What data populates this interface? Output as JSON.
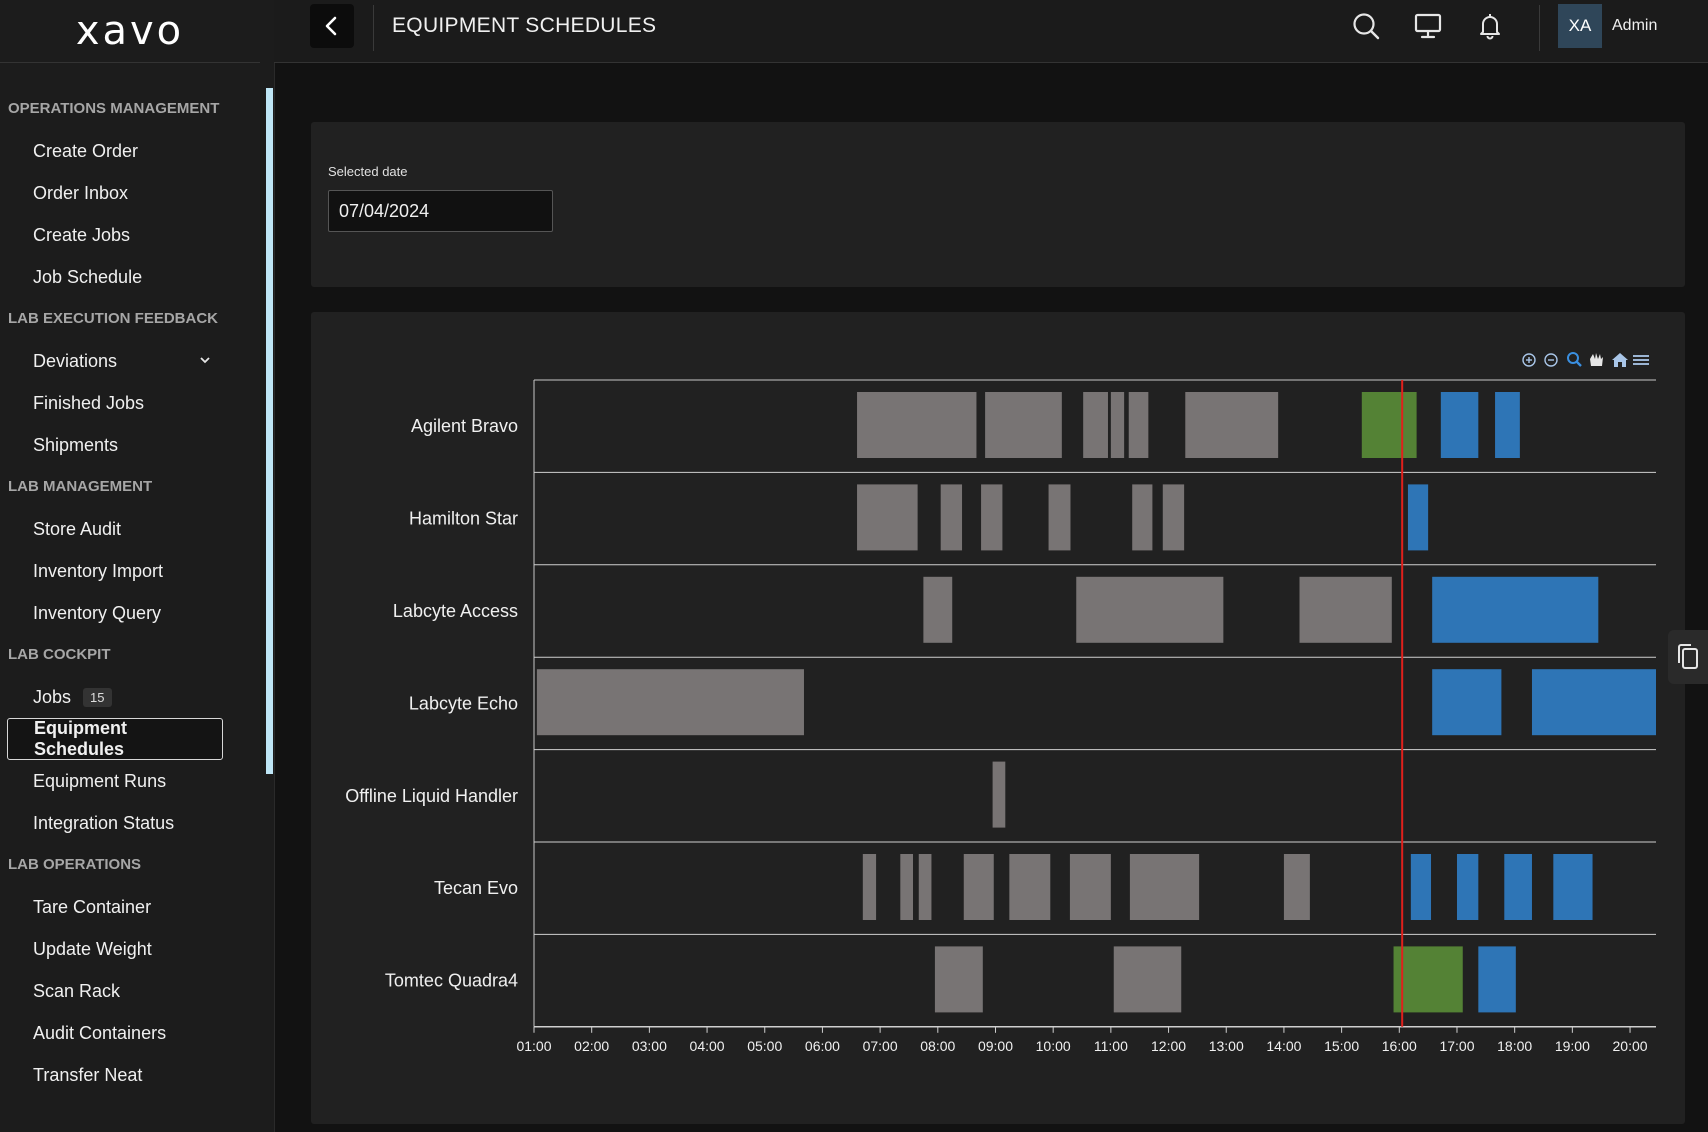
{
  "app": {
    "logo": "xavo"
  },
  "header": {
    "title": "EQUIPMENT SCHEDULES",
    "avatar_initials": "XA",
    "user_name": "Admin"
  },
  "sidebar": {
    "sections": [
      {
        "title": "OPERATIONS MANAGEMENT",
        "items": [
          {
            "label": "Create Order"
          },
          {
            "label": "Order Inbox"
          },
          {
            "label": "Create Jobs"
          },
          {
            "label": "Job Schedule"
          }
        ]
      },
      {
        "title": "LAB EXECUTION FEEDBACK",
        "items": [
          {
            "label": "Deviations",
            "expandable": true
          },
          {
            "label": "Finished Jobs"
          },
          {
            "label": "Shipments"
          }
        ]
      },
      {
        "title": "LAB MANAGEMENT",
        "items": [
          {
            "label": "Store Audit"
          },
          {
            "label": "Inventory Import"
          },
          {
            "label": "Inventory Query"
          }
        ]
      },
      {
        "title": "LAB COCKPIT",
        "items": [
          {
            "label": "Jobs",
            "badge": "15"
          },
          {
            "label": "Equipment Schedules",
            "active": true
          },
          {
            "label": "Equipment Runs"
          },
          {
            "label": "Integration Status"
          }
        ]
      },
      {
        "title": "LAB OPERATIONS",
        "items": [
          {
            "label": "Tare Container"
          },
          {
            "label": "Update Weight"
          },
          {
            "label": "Scan Rack"
          },
          {
            "label": "Audit Containers"
          },
          {
            "label": "Transfer Neat"
          }
        ]
      }
    ]
  },
  "date_filter": {
    "label": "Selected date",
    "value": "07/04/2024"
  },
  "chart_data": {
    "type": "timeline",
    "toolbar": [
      "zoom-in-icon",
      "zoom-out-icon",
      "selection-zoom-icon",
      "pan-icon",
      "reset-home-icon",
      "menu-icon"
    ],
    "x_ticks": [
      "01:00",
      "02:00",
      "03:00",
      "04:00",
      "05:00",
      "06:00",
      "07:00",
      "08:00",
      "09:00",
      "10:00",
      "11:00",
      "12:00",
      "13:00",
      "14:00",
      "15:00",
      "16:00",
      "17:00",
      "18:00",
      "19:00",
      "20:00"
    ],
    "xlim": [
      1.0,
      20.45
    ],
    "now_marker": 16.05,
    "colors": {
      "completed": "#787474",
      "running": "#548235",
      "scheduled": "#2e75b6",
      "now": "#e0201c"
    },
    "rows": [
      {
        "name": "Agilent Bravo",
        "tasks": [
          {
            "start": 6.6,
            "end": 8.67,
            "status": "completed"
          },
          {
            "start": 8.82,
            "end": 10.15,
            "status": "completed"
          },
          {
            "start": 10.52,
            "end": 10.95,
            "status": "completed"
          },
          {
            "start": 11.0,
            "end": 11.23,
            "status": "completed"
          },
          {
            "start": 11.31,
            "end": 11.65,
            "status": "completed"
          },
          {
            "start": 12.29,
            "end": 13.9,
            "status": "completed"
          },
          {
            "start": 15.35,
            "end": 16.3,
            "status": "running"
          },
          {
            "start": 16.72,
            "end": 17.37,
            "status": "scheduled"
          },
          {
            "start": 17.66,
            "end": 18.09,
            "status": "scheduled"
          }
        ]
      },
      {
        "name": "Hamilton Star",
        "tasks": [
          {
            "start": 6.6,
            "end": 7.65,
            "status": "completed"
          },
          {
            "start": 8.05,
            "end": 8.42,
            "status": "completed"
          },
          {
            "start": 8.75,
            "end": 9.12,
            "status": "completed"
          },
          {
            "start": 9.92,
            "end": 10.3,
            "status": "completed"
          },
          {
            "start": 11.37,
            "end": 11.72,
            "status": "completed"
          },
          {
            "start": 11.9,
            "end": 12.27,
            "status": "completed"
          },
          {
            "start": 16.15,
            "end": 16.5,
            "status": "scheduled"
          }
        ]
      },
      {
        "name": "Labcyte Access",
        "tasks": [
          {
            "start": 7.75,
            "end": 8.25,
            "status": "completed"
          },
          {
            "start": 10.4,
            "end": 12.95,
            "status": "completed"
          },
          {
            "start": 14.27,
            "end": 15.87,
            "status": "completed"
          },
          {
            "start": 16.57,
            "end": 19.45,
            "status": "scheduled"
          }
        ]
      },
      {
        "name": "Labcyte Echo",
        "tasks": [
          {
            "start": 1.05,
            "end": 5.68,
            "status": "completed"
          },
          {
            "start": 16.57,
            "end": 17.77,
            "status": "scheduled"
          },
          {
            "start": 18.3,
            "end": 20.45,
            "status": "scheduled"
          }
        ]
      },
      {
        "name": "Offline Liquid Handler",
        "tasks": [
          {
            "start": 8.95,
            "end": 9.17,
            "status": "completed"
          }
        ]
      },
      {
        "name": "Tecan Evo",
        "tasks": [
          {
            "start": 6.7,
            "end": 6.93,
            "status": "completed"
          },
          {
            "start": 7.35,
            "end": 7.57,
            "status": "completed"
          },
          {
            "start": 7.67,
            "end": 7.89,
            "status": "completed"
          },
          {
            "start": 8.45,
            "end": 8.97,
            "status": "completed"
          },
          {
            "start": 9.24,
            "end": 9.95,
            "status": "completed"
          },
          {
            "start": 10.29,
            "end": 11.0,
            "status": "completed"
          },
          {
            "start": 11.33,
            "end": 12.53,
            "status": "completed"
          },
          {
            "start": 14.0,
            "end": 14.45,
            "status": "completed"
          },
          {
            "start": 16.2,
            "end": 16.55,
            "status": "scheduled"
          },
          {
            "start": 17.0,
            "end": 17.37,
            "status": "scheduled"
          },
          {
            "start": 17.82,
            "end": 18.3,
            "status": "scheduled"
          },
          {
            "start": 18.67,
            "end": 19.35,
            "status": "scheduled"
          }
        ]
      },
      {
        "name": "Tomtec Quadra4",
        "tasks": [
          {
            "start": 7.95,
            "end": 8.78,
            "status": "completed"
          },
          {
            "start": 11.05,
            "end": 12.22,
            "status": "completed"
          },
          {
            "start": 15.9,
            "end": 17.1,
            "status": "running"
          },
          {
            "start": 17.37,
            "end": 18.02,
            "status": "scheduled"
          }
        ]
      }
    ]
  }
}
